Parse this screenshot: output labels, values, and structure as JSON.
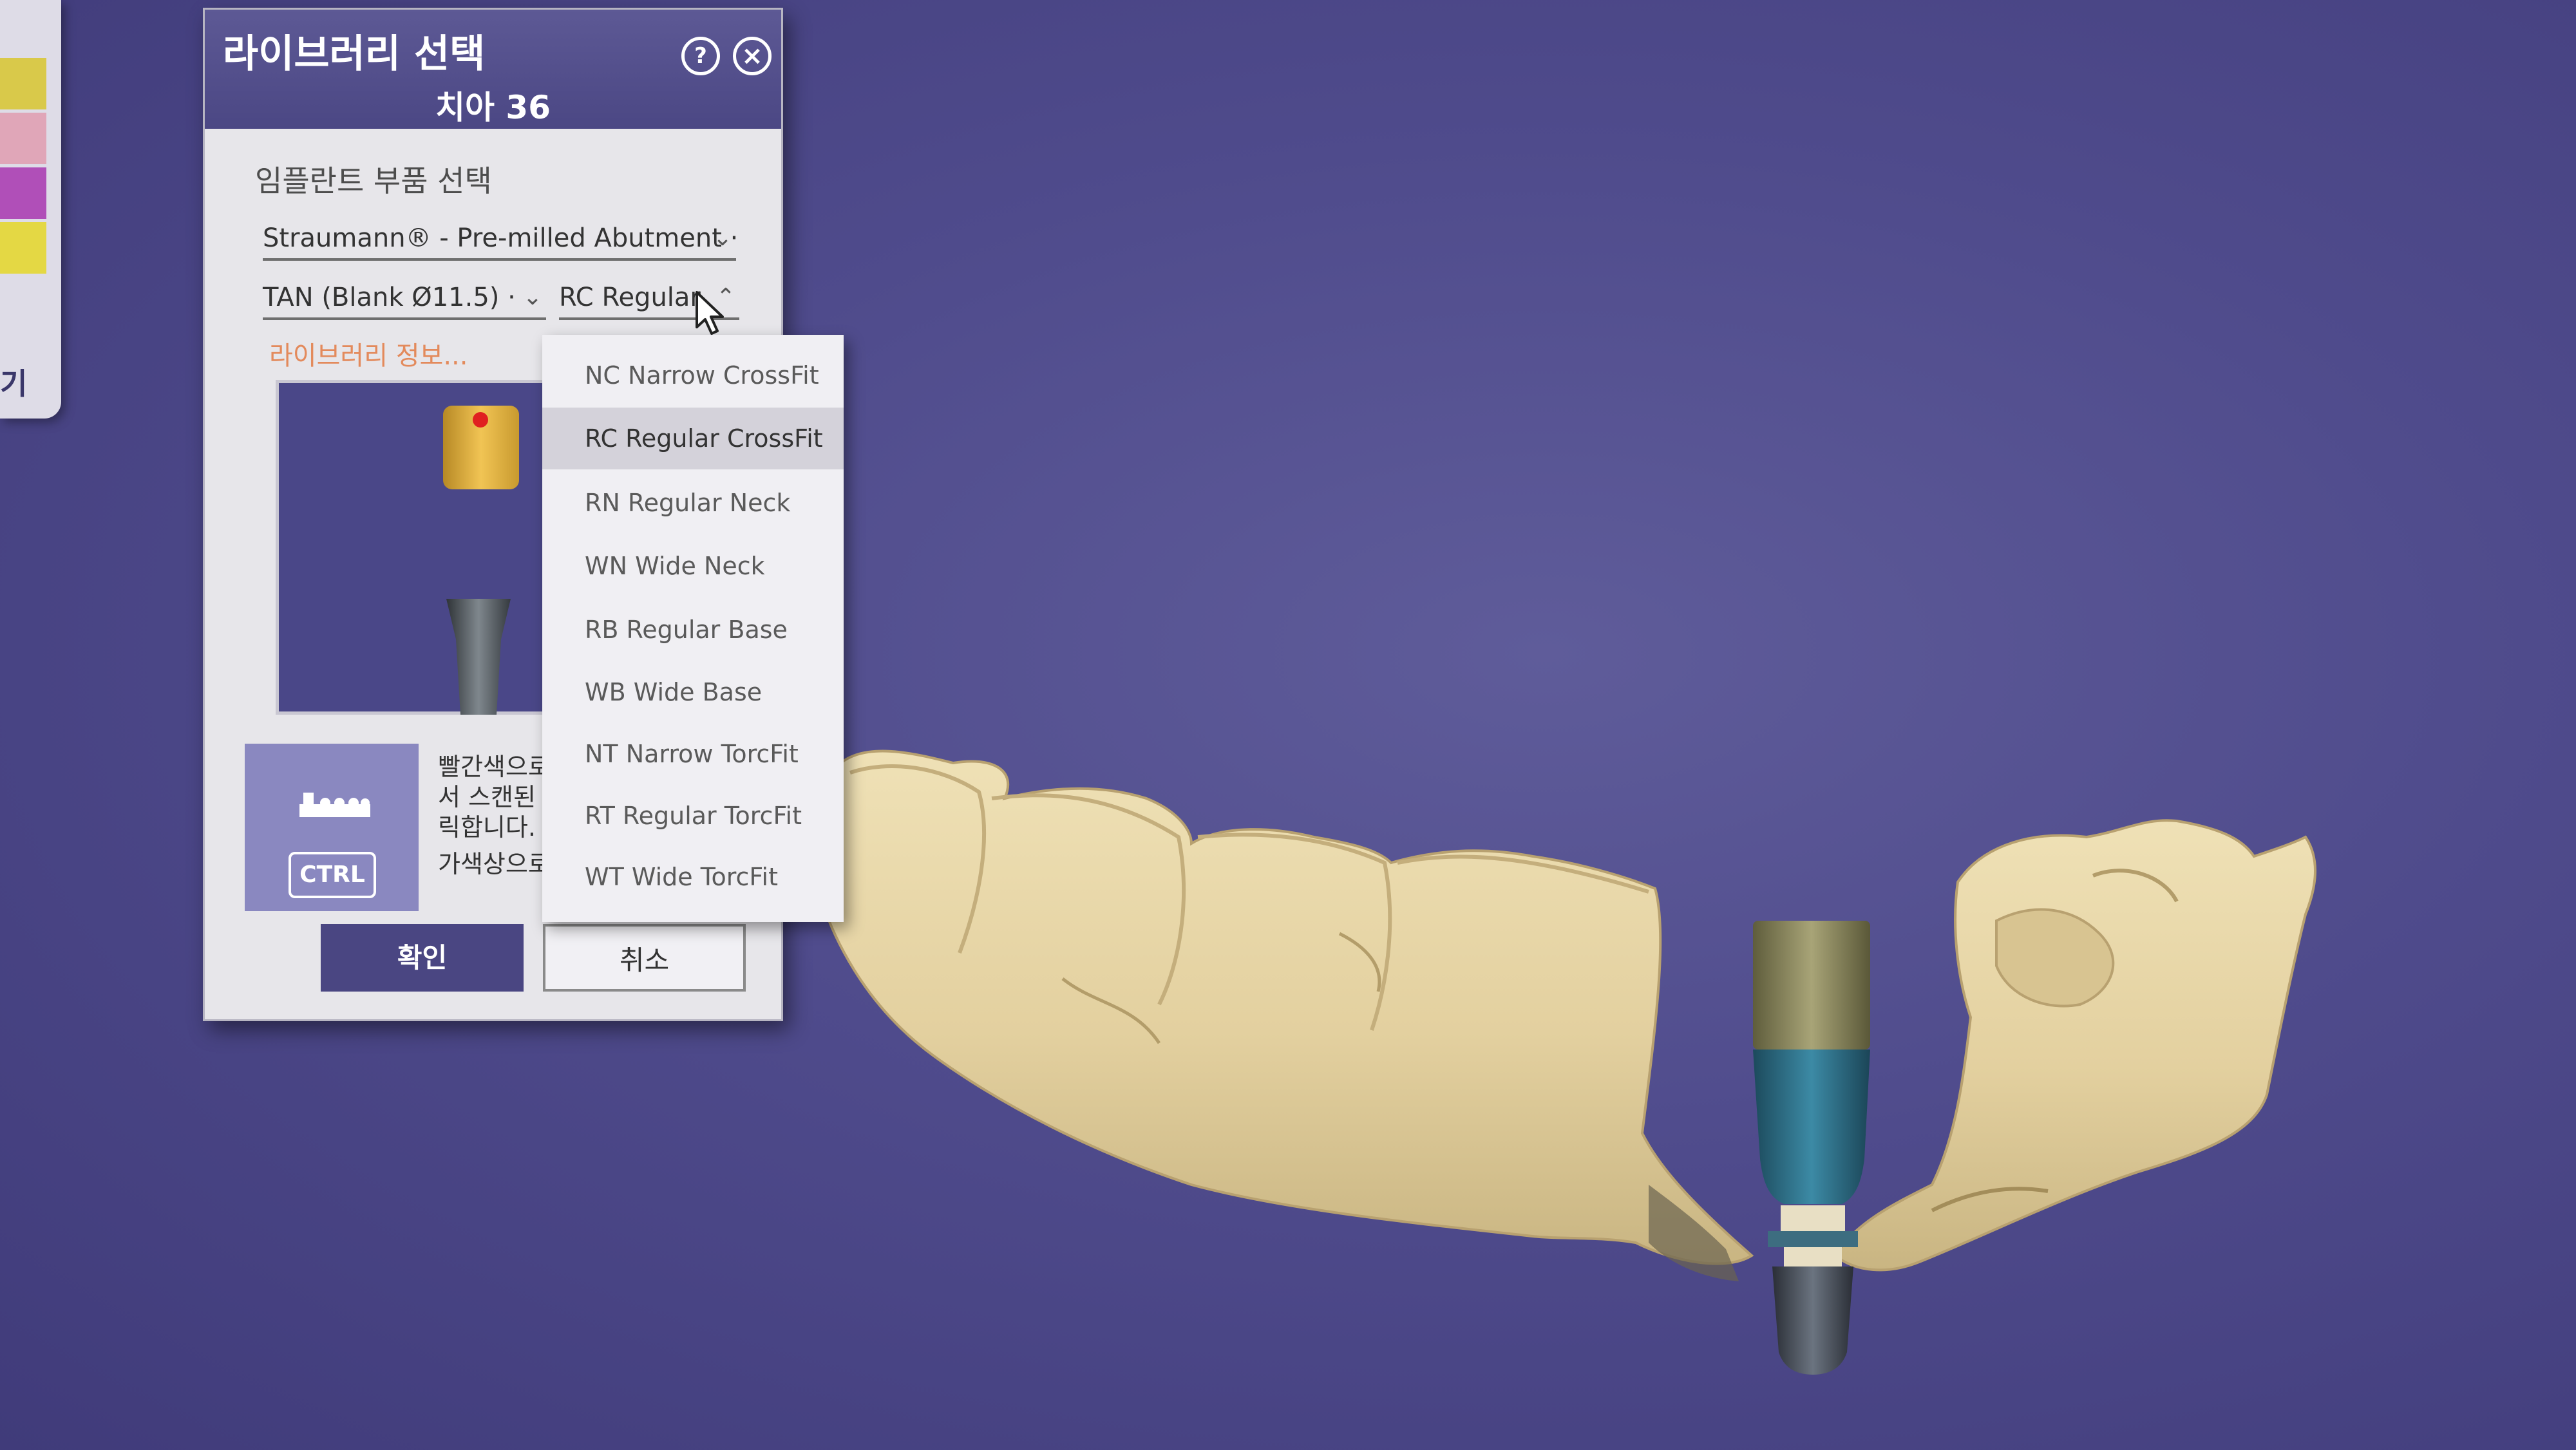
{
  "side_panel": {
    "label": "기",
    "swatches": [
      "#d9c94a",
      "#e0a6b8",
      "#b04fb8",
      "#e4d844"
    ]
  },
  "dialog": {
    "title": "라이브러리 선택",
    "subtitle": "치아 36",
    "help_icon": "question-icon",
    "close_icon": "close-icon",
    "section_label": "임플란트 부품 선택",
    "manufacturer_select": {
      "value": "Straumann® - Pre-milled Abutment ·"
    },
    "material_select": {
      "value": "TAN (Blank Ø11.5) ·"
    },
    "connection_select": {
      "value": "RC Regular"
    },
    "library_info_link": "라이브러리 정보...",
    "hint": {
      "line1": "빨간색으로",
      "line2": "서 스캔된 스",
      "line3": "릭합니다.",
      "line4": "가색상으로",
      "ctrl_key": "CTRL"
    },
    "ok_button": "확인",
    "cancel_button": "취소"
  },
  "dropdown": {
    "items": [
      "NC Narrow CrossFit",
      "RC Regular CrossFit",
      "RN Regular Neck",
      "WN Wide Neck",
      "RB Regular Base",
      "WB Wide Base",
      "NT Narrow TorcFit",
      "RT Regular TorcFit",
      "WT Wide TorcFit"
    ],
    "selected": "RC Regular CrossFit"
  },
  "colors": {
    "background": "#4f4b8c",
    "header": "#4b4784",
    "model": "#e6d5a7",
    "implant_gold": "#8d8a5c",
    "implant_blue": "#2f6f86",
    "link": "#e38a5c"
  }
}
